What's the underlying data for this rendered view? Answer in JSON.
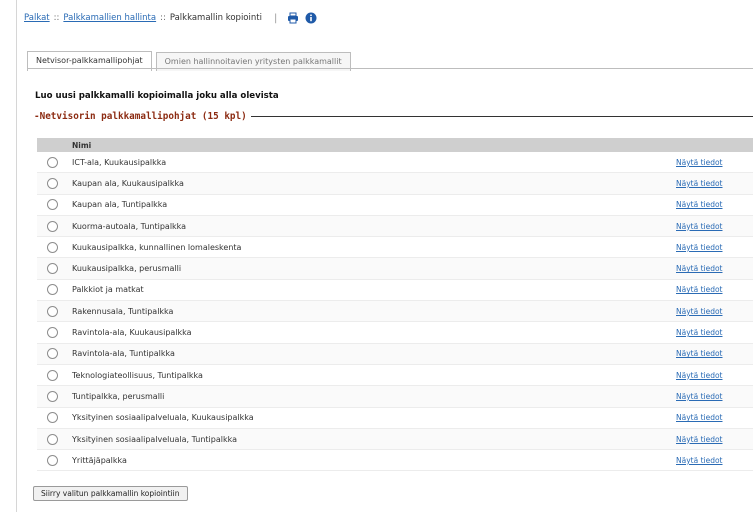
{
  "breadcrumb": {
    "items": [
      "Palkat",
      "Palkkamallien hallinta",
      "Palkkamallin kopiointi"
    ],
    "separator": "::"
  },
  "toolbar": {
    "icons": [
      "print-icon",
      "info-icon"
    ],
    "accent": "#2a6bb5"
  },
  "tabs": [
    {
      "label": "Netvisor-palkkamallipohjat",
      "active": true
    },
    {
      "label": "Omien hallinnoitavien yritysten palkkamallit",
      "active": false
    }
  ],
  "intro_text": "Luo uusi palkkamalli kopioimalla joku alla olevista",
  "section_title": "Netvisorin palkkamallipohjat (15 kpl)",
  "table": {
    "header": "Nimi",
    "link_label": "Näytä tiedot",
    "rows": [
      "ICT-ala, Kuukausipalkka",
      "Kaupan ala, Kuukausipalkka",
      "Kaupan ala, Tuntipalkka",
      "Kuorma-autoala, Tuntipalkka",
      "Kuukausipalkka, kunnallinen lomaleskenta",
      "Kuukausipalkka, perusmalli",
      "Palkkiot ja matkat",
      "Rakennusala, Tuntipalkka",
      "Ravintola-ala, Kuukausipalkka",
      "Ravintola-ala, Tuntipalkka",
      "Teknologiateollisuus, Tuntipalkka",
      "Tuntipalkka, perusmalli",
      "Yksityinen sosiaalipalveluala, Kuukausipalkka",
      "Yksityinen sosiaalipalveluala, Tuntipalkka",
      "Yrittäjäpalkka"
    ]
  },
  "submit_label": "Siirry valitun palkkamallin kopiointiin",
  "colors": {
    "link": "#2a6bb5",
    "section_title": "#8c2b12",
    "table_header_bg": "#cfcfcf"
  }
}
